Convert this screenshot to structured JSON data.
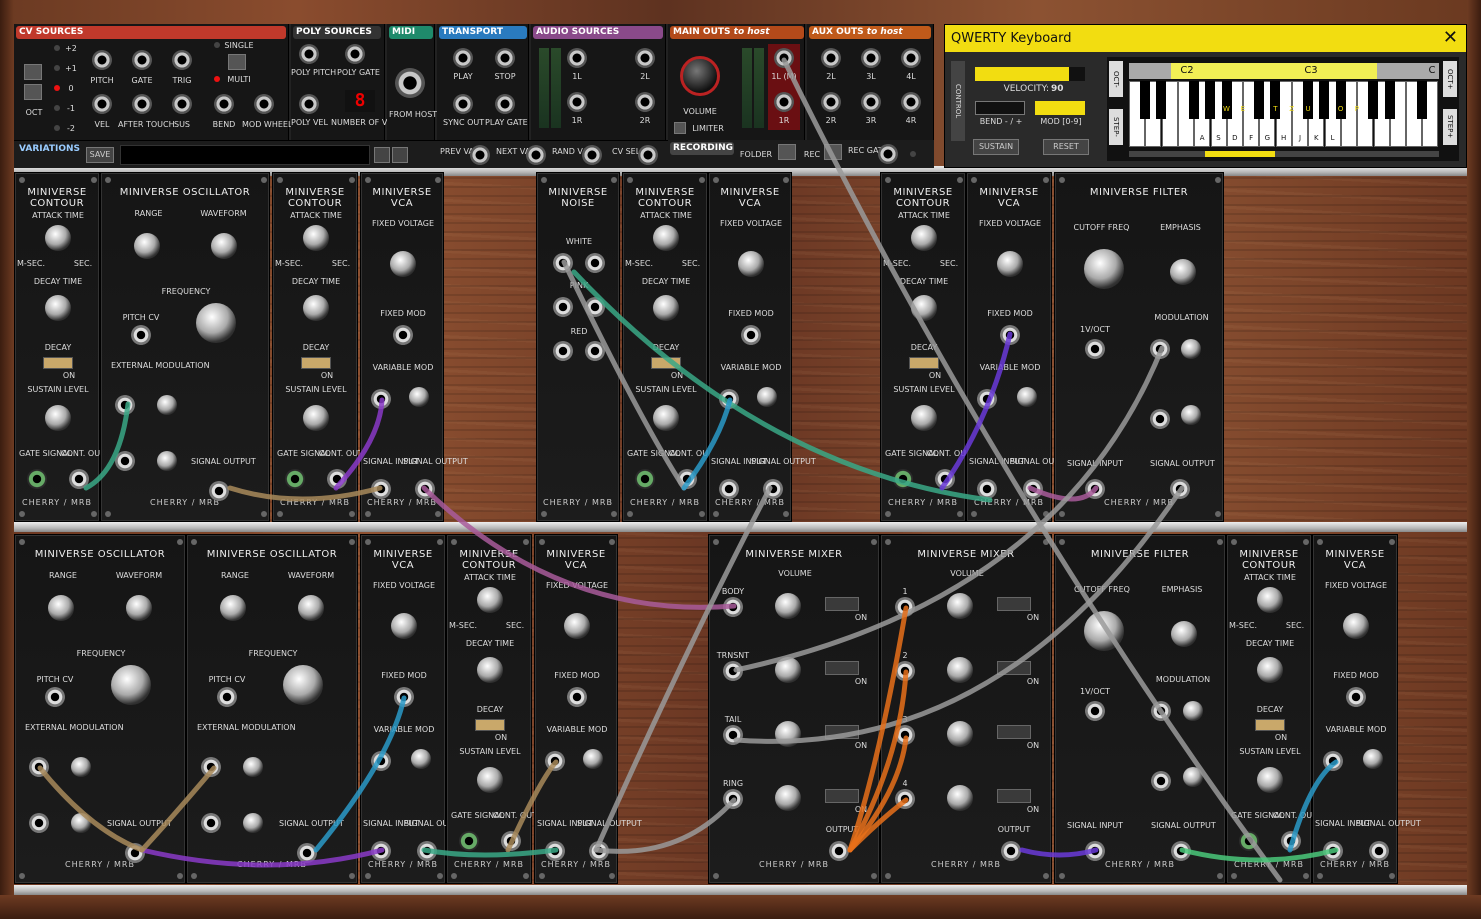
{
  "toolbar": {
    "cv_sources": {
      "title": "CV SOURCES",
      "oct_values": [
        "+2",
        "+1",
        "0",
        "-1",
        "-2"
      ],
      "oct_label": "OCT",
      "single": "SINGLE",
      "multi": "MULTI",
      "jacks": [
        "PITCH",
        "GATE",
        "TRIG",
        "VEL",
        "AFTER TOUCH",
        "SUS",
        "BEND",
        "MOD WHEEL"
      ]
    },
    "poly_sources": {
      "title": "POLY SOURCES",
      "labels": [
        "POLY PITCH",
        "POLY GATE",
        "POLY VEL",
        "NUMBER OF VOICES"
      ],
      "voices": "8"
    },
    "midi": {
      "title": "MIDI",
      "label": "FROM HOST"
    },
    "transport": {
      "title": "TRANSPORT",
      "labels": [
        "PLAY",
        "STOP",
        "SYNC OUT",
        "PLAY GATE"
      ]
    },
    "audio_sources": {
      "title": "AUDIO SOURCES",
      "labels": [
        "1L",
        "2L",
        "1R",
        "2R"
      ]
    },
    "main_outs": {
      "title": "MAIN OUTS",
      "suffix": "to host",
      "volume": "VOLUME",
      "limiter": "LIMITER",
      "labels": [
        "1L (M)",
        "1R"
      ]
    },
    "aux_outs": {
      "title": "AUX OUTS",
      "suffix": "to host",
      "labels": [
        "2L",
        "3L",
        "4L",
        "2R",
        "3R",
        "4R"
      ]
    },
    "variations": {
      "title": "VARIATIONS",
      "save": "SAVE",
      "prev": "PREV VAR",
      "next": "NEXT VAR",
      "rand": "RAND VAR",
      "cv_sel": "CV SEL"
    },
    "recording": {
      "title": "RECORDING",
      "folder": "FOLDER",
      "rec": "REC",
      "rec_gate": "REC GATE"
    }
  },
  "qwerty": {
    "title": "QWERTY Keyboard",
    "close": "✕",
    "control": "CONTROL",
    "velocity_label": "VELOCITY:",
    "velocity": "90",
    "velocity_fraction": 0.85,
    "bend": "BEND - / +",
    "mod": "MOD [0-9]",
    "sustain": "SUSTAIN",
    "reset": "RESET",
    "oct_minus": "OCT-",
    "oct_plus": "OCT+",
    "step_minus": "STEP-",
    "step_plus": "STEP+",
    "range_labels": [
      "C2",
      "C3",
      "C"
    ],
    "upper_keys": [
      "W",
      "E",
      "T",
      "Z",
      "U",
      "O",
      "P"
    ],
    "lower_keys": [
      "A",
      "S",
      "D",
      "F",
      "G",
      "H",
      "J",
      "K",
      "L"
    ]
  },
  "modules_row1": [
    {
      "title": "MINIVERSE CONTOUR",
      "foot": "CHERRY / MRB"
    },
    {
      "title": "MINIVERSE OSCILLATOR",
      "foot": "CHERRY / MRB"
    },
    {
      "title": "MINIVERSE CONTOUR",
      "foot": "CHERRY / MRB"
    },
    {
      "title": "MINIVERSE VCA",
      "foot": "CHERRY / MRB"
    },
    {
      "title": "MINIVERSE NOISE",
      "foot": "CHERRY / MRB"
    },
    {
      "title": "MINIVERSE CONTOUR",
      "foot": "CHERRY / MRB"
    },
    {
      "title": "MINIVERSE VCA",
      "foot": "CHERRY / MRB"
    },
    {
      "title": "MINIVERSE CONTOUR",
      "foot": "CHERRY / MRB"
    },
    {
      "title": "MINIVERSE VCA",
      "foot": "CHERRY / MRB"
    },
    {
      "title": "MINIVERSE FILTER",
      "foot": "CHERRY / MRB"
    }
  ],
  "modules_row2": [
    {
      "title": "MINIVERSE OSCILLATOR",
      "foot": "CHERRY / MRB"
    },
    {
      "title": "MINIVERSE OSCILLATOR",
      "foot": "CHERRY / MRB"
    },
    {
      "title": "MINIVERSE VCA",
      "foot": "CHERRY / MRB"
    },
    {
      "title": "MINIVERSE CONTOUR",
      "foot": "CHERRY / MRB"
    },
    {
      "title": "MINIVERSE VCA",
      "foot": "CHERRY / MRB"
    },
    {
      "title": "MINIVERSE MIXER",
      "foot": "CHERRY / MRB"
    },
    {
      "title": "MINIVERSE MIXER",
      "foot": "CHERRY / MRB"
    },
    {
      "title": "MINIVERSE FILTER",
      "foot": "CHERRY / MRB"
    },
    {
      "title": "MINIVERSE CONTOUR",
      "foot": "CHERRY / MRB"
    },
    {
      "title": "MINIVERSE VCA",
      "foot": "CHERRY / MRB"
    }
  ],
  "labels": {
    "attack": "ATTACK TIME",
    "decay_time": "DECAY TIME",
    "decay": "DECAY",
    "on": "ON",
    "sustain": "SUSTAIN LEVEL",
    "gate": "GATE SIGNAL",
    "cont": "CONT. OUTPUT",
    "range": "RANGE",
    "waveform": "WAVEFORM",
    "frequency": "FREQUENCY",
    "pitch_cv": "PITCH CV",
    "ext_mod": "EXTERNAL MODULATION",
    "signal_out": "SIGNAL OUTPUT",
    "signal_in": "SIGNAL INPUT",
    "fixed_voltage": "FIXED VOLTAGE",
    "fixed_mod": "FIXED MOD",
    "variable_mod": "VARIABLE MOD",
    "white": "WHITE",
    "pink": "PINK",
    "red": "RED",
    "cutoff": "CUTOFF FREQ",
    "emphasis": "EMPHASIS",
    "v_oct": "1V/OCT",
    "modulation": "MODULATION",
    "volume": "VOLUME",
    "output": "OUTPUT",
    "msec": "M-SEC.",
    "sec": "SEC.",
    "mixer1_channels": [
      "BODY",
      "TRNSNT",
      "TAIL",
      "RING"
    ],
    "mixer2_channels": [
      "1",
      "2",
      "3",
      "4"
    ]
  },
  "colors": {
    "cv": "#c0392b",
    "poly": "#2a2a2a",
    "midi": "#1f8a6b",
    "transport": "#2a7bbf",
    "audio": "#8a4a8a",
    "main": "#b34a1a",
    "aux": "#c05a1a",
    "qwerty": "#f2dd11",
    "cable_teal": "#3aa886",
    "cable_tan": "#a88a5a",
    "cable_purple": "#8a3ac8",
    "cable_pink": "#a85a9a",
    "cable_gray": "#9a9a9a",
    "cable_orange": "#e8701a",
    "cable_blue": "#2a9ac8",
    "cable_green": "#4ac87a",
    "cable_violet": "#6a3ad8"
  }
}
